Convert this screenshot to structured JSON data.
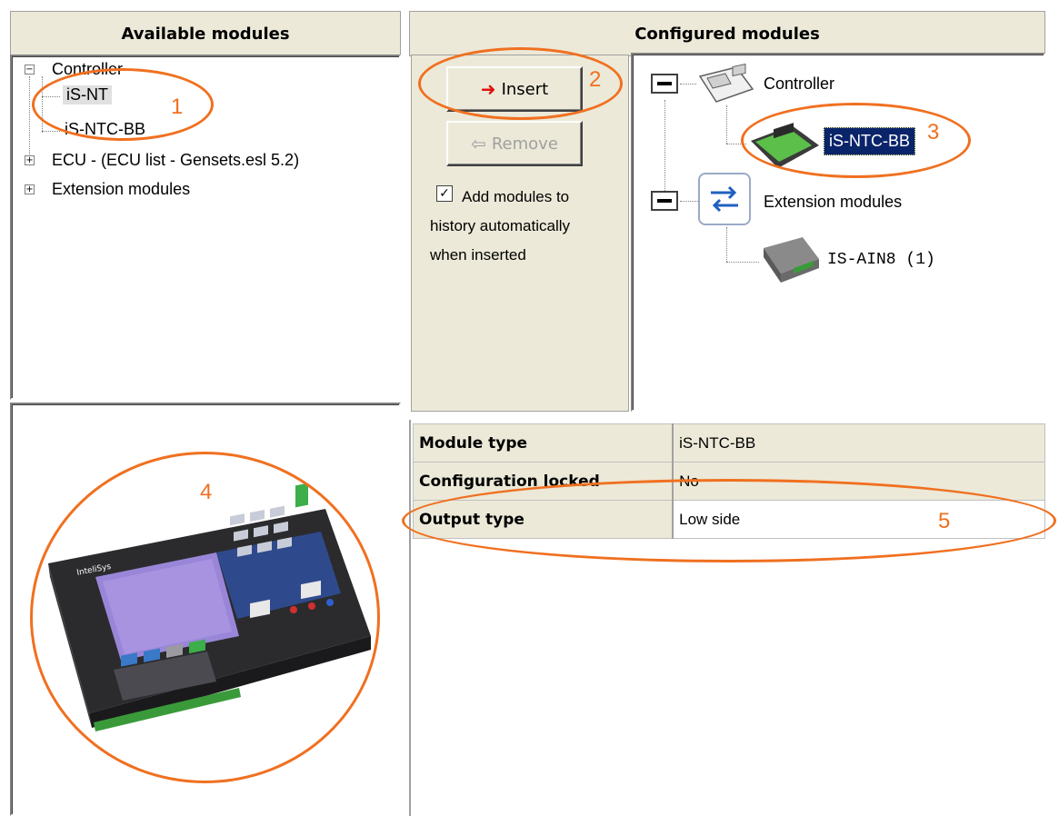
{
  "available": {
    "title": "Available modules",
    "tree": [
      {
        "label": "Controller",
        "expanded": true,
        "children": [
          "iS-NT",
          "iS-NTC-BB"
        ],
        "selected_child": "iS-NT"
      },
      {
        "label": "ECU - (ECU list - Gensets.esl 5.2)",
        "expanded": false
      },
      {
        "label": "Extension modules",
        "expanded": false
      }
    ]
  },
  "configured": {
    "title": "Configured modules",
    "insert_label": "Insert",
    "remove_label": "Remove",
    "history_checkbox": {
      "checked": true,
      "label_line1": "Add modules to",
      "label_line2": "history automatically",
      "label_line3": "when inserted"
    },
    "tree": {
      "controller_label": "Controller",
      "controller_child": "iS-NTC-BB",
      "extension_label": "Extension modules",
      "extension_child": "IS-AIN8 (1)"
    }
  },
  "properties": [
    {
      "key": "Module type",
      "value": "iS-NTC-BB"
    },
    {
      "key": "Configuration locked",
      "value": "No"
    },
    {
      "key": "Output type",
      "value": "Low side"
    }
  ],
  "preview": {
    "brand": "InteliSys"
  },
  "callouts": [
    "1",
    "2",
    "3",
    "4",
    "5"
  ],
  "colors": {
    "callout": "#f07020",
    "selection": "#0a246a",
    "panel": "#ece9d8"
  }
}
